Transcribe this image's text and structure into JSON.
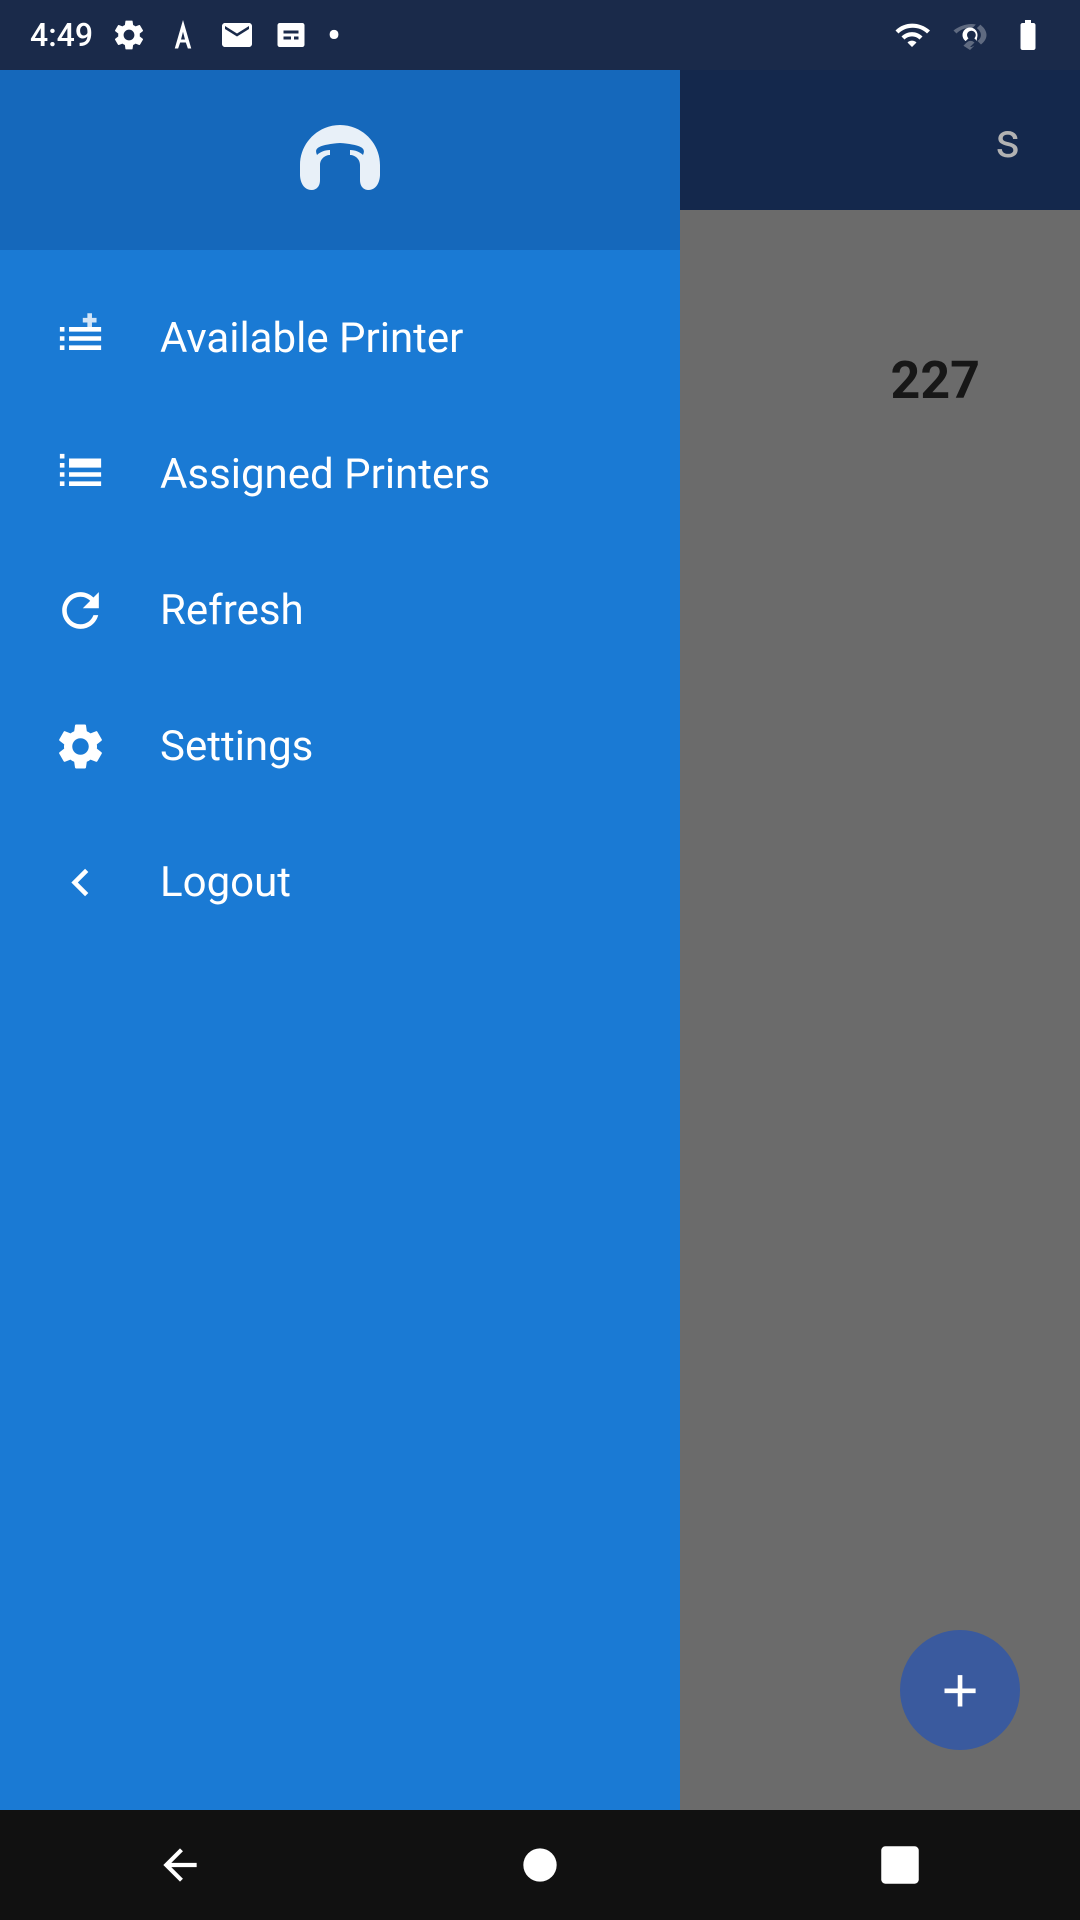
{
  "statusBar": {
    "time": "4:49",
    "icons": [
      "settings",
      "text-a",
      "gmail",
      "sim",
      "dot"
    ]
  },
  "appHeader": {
    "title": "s"
  },
  "content": {
    "number": "227"
  },
  "drawer": {
    "menuItems": [
      {
        "id": "available-printer",
        "icon": "list-add",
        "label": "Available Printer"
      },
      {
        "id": "assigned-printers",
        "icon": "list-view",
        "label": "Assigned Printers"
      },
      {
        "id": "refresh",
        "icon": "refresh",
        "label": "Refresh"
      },
      {
        "id": "settings",
        "icon": "gear",
        "label": "Settings"
      },
      {
        "id": "logout",
        "icon": "back-arrow",
        "label": "Logout"
      }
    ]
  },
  "fab": {
    "label": "+"
  },
  "bottomNav": {
    "back": "◀",
    "home": "●",
    "recent": "■"
  }
}
